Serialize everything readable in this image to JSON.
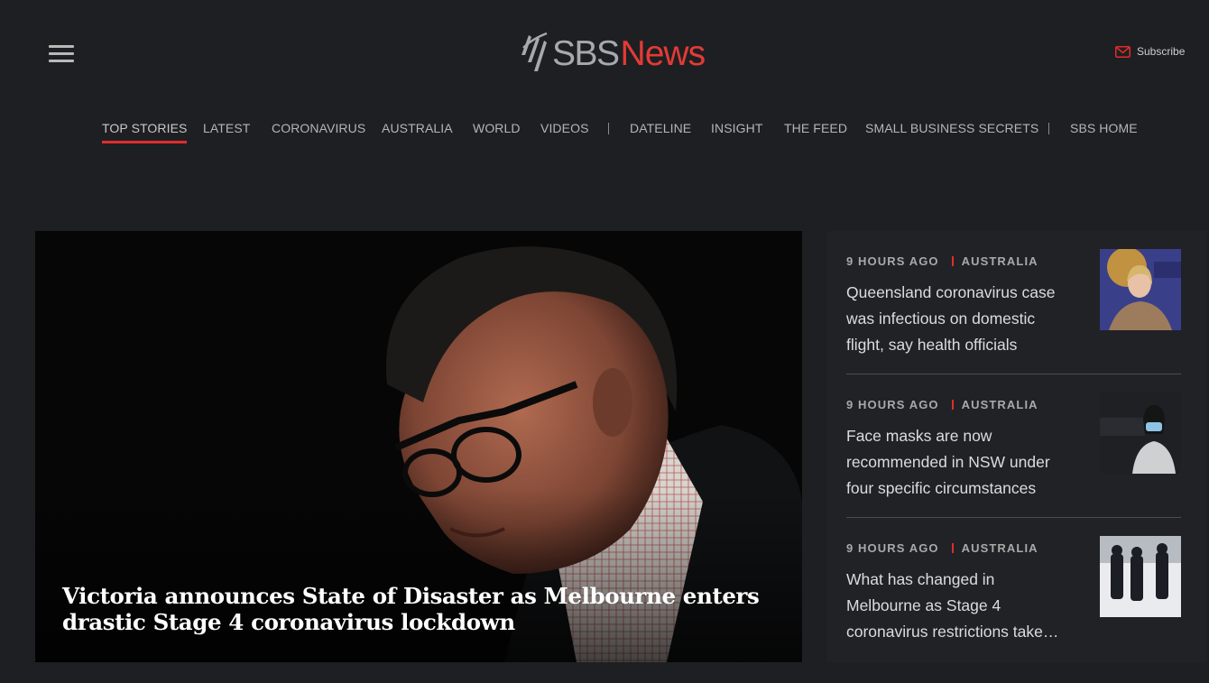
{
  "header": {
    "logo_sbs": "SBS",
    "logo_news": "News",
    "subscribe_label": "Subscribe"
  },
  "nav": {
    "items": [
      "TOP STORIES",
      "LATEST",
      "CORONAVIRUS",
      "AUSTRALIA",
      "WORLD",
      "VIDEOS",
      "DATELINE",
      "INSIGHT",
      "THE FEED",
      "SMALL BUSINESS SECRETS",
      "SBS HOME"
    ],
    "active": "TOP STORIES"
  },
  "hero": {
    "title": "Victoria announces State of Disaster as Melbourne enters drastic Stage 4 coronavirus lockdown"
  },
  "stories": [
    {
      "time": "9 HOURS AGO",
      "category": "AUSTRALIA",
      "title": "Queensland coronavirus case was infectious on domestic flight, say health officials"
    },
    {
      "time": "9 HOURS AGO",
      "category": "AUSTRALIA",
      "title": "Face masks are now recommended in NSW under four specific circumstances"
    },
    {
      "time": "9 HOURS AGO",
      "category": "AUSTRALIA",
      "title": "What has changed in Melbourne as Stage 4 coronavirus restrictions take…"
    }
  ],
  "colors": {
    "background": "#1e1f22",
    "accent": "#e02d2b",
    "logo_grey": "#a7a9ac",
    "logo_red": "#e33b36"
  }
}
